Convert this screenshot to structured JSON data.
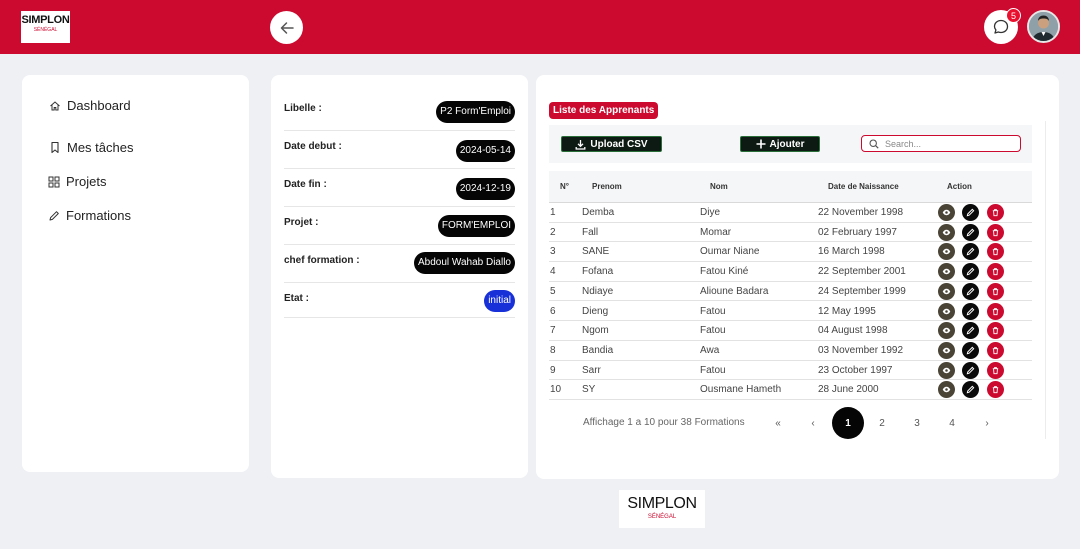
{
  "header": {
    "logo_main": "SIMPLON",
    "logo_sub": "SÉNÉGAL",
    "notification_count": "5",
    "brand_color": "#cc0a2f"
  },
  "sidebar": {
    "items": [
      {
        "label": "Dashboard",
        "icon": "home-icon"
      },
      {
        "label": "Mes tâches",
        "icon": "bookmark-icon"
      },
      {
        "label": "Projets",
        "icon": "grid-icon"
      },
      {
        "label": "Formations",
        "icon": "pencil-icon"
      }
    ]
  },
  "details": {
    "rows": [
      {
        "label": "Libelle :",
        "value": "P2 Form'Emploi"
      },
      {
        "label": "Date debut :",
        "value": "2024-05-14"
      },
      {
        "label": "Date fin :",
        "value": "2024-12-19"
      },
      {
        "label": "Projet :",
        "value": "FORM'EMPLOI"
      },
      {
        "label": "chef formation :",
        "value": "Abdoul Wahab Diallo"
      },
      {
        "label": "Etat :",
        "value": "initial"
      }
    ]
  },
  "learners": {
    "title": "Liste des Apprenants",
    "upload_label": "Upload CSV",
    "add_label": "Ajouter",
    "search_placeholder": "Search...",
    "columns": [
      "N°",
      "Prenom",
      "Nom",
      "Date de Naissance",
      "Action"
    ],
    "rows": [
      {
        "n": "1",
        "prenom": "Demba",
        "nom": "Diye",
        "naissance": "22 November 1998"
      },
      {
        "n": "2",
        "prenom": "Fall",
        "nom": "Momar",
        "naissance": "02 February 1997"
      },
      {
        "n": "3",
        "prenom": "SANE",
        "nom": "Oumar Niane",
        "naissance": "16 March 1998"
      },
      {
        "n": "4",
        "prenom": "Fofana",
        "nom": "Fatou Kiné",
        "naissance": "22 September 2001"
      },
      {
        "n": "5",
        "prenom": "Ndiaye",
        "nom": "Alioune Badara",
        "naissance": "24 September 1999"
      },
      {
        "n": "6",
        "prenom": "Dieng",
        "nom": "Fatou",
        "naissance": "12 May 1995"
      },
      {
        "n": "7",
        "prenom": "Ngom",
        "nom": "Fatou",
        "naissance": "04 August 1998"
      },
      {
        "n": "8",
        "prenom": "Bandia",
        "nom": "Awa",
        "naissance": "03 November 1992"
      },
      {
        "n": "9",
        "prenom": "Sarr",
        "nom": "Fatou",
        "naissance": "23 October 1997"
      },
      {
        "n": "10",
        "prenom": "SY",
        "nom": "Ousmane Hameth",
        "naissance": "28 June 2000"
      }
    ],
    "pagination": {
      "info": "Affichage 1 a 10 pour 38 Formations",
      "first": "«",
      "prev": "‹",
      "pages": [
        "1",
        "2",
        "3",
        "4"
      ],
      "active_page": "1",
      "next": "›"
    }
  },
  "footer": {
    "logo_main": "SIMPLON",
    "logo_sub": "SÉNÉGAL"
  }
}
